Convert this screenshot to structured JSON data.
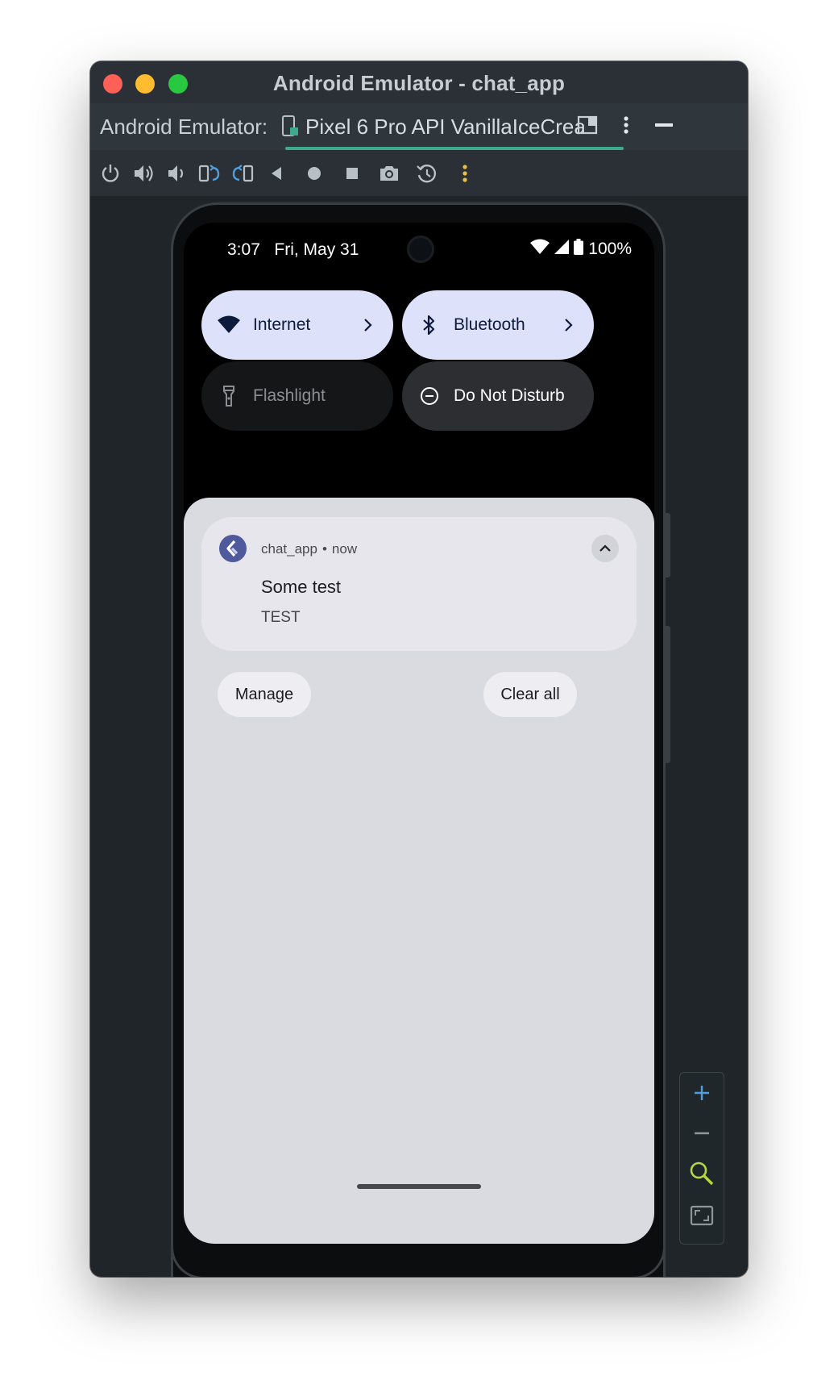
{
  "window": {
    "title": "Android Emulator - chat_app"
  },
  "tabs": {
    "prefix": "Android Emulator:",
    "device": "Pixel 6 Pro API VanillaIceCrea"
  },
  "status_bar": {
    "time_date": "3:07   Fri, May 31",
    "battery": "100%"
  },
  "quick_settings": {
    "internet": "Internet",
    "bluetooth": "Bluetooth",
    "flashlight": "Flashlight",
    "dnd": "Do Not Disturb"
  },
  "notification": {
    "app": "chat_app",
    "separator": "•",
    "time": "now",
    "title": "Some test",
    "body": "TEST"
  },
  "shade_actions": {
    "manage": "Manage",
    "clear_all": "Clear all"
  },
  "colors": {
    "window_bg": "#1f2528",
    "tab_accent": "#3fa98c",
    "qs_active": "#dde2fa",
    "shade_bg": "#dadbe0"
  },
  "icons": {
    "toolbar": [
      "power-icon",
      "volume-up-icon",
      "volume-down-icon",
      "rotate-left-icon",
      "rotate-right-icon",
      "back-icon",
      "home-icon",
      "overview-icon",
      "camera-icon",
      "snapshot-icon",
      "more-vert-icon"
    ],
    "zoom": [
      "zoom-in-icon",
      "zoom-out-icon",
      "zoom-actual-icon",
      "fit-screen-icon"
    ]
  }
}
